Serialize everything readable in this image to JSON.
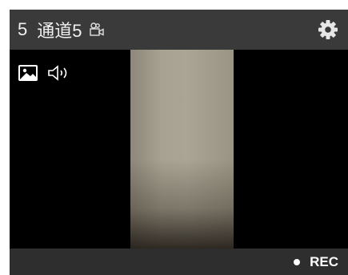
{
  "header": {
    "channel_number": "5",
    "channel_name": "通道5",
    "camera_icon": "camera-icon",
    "settings_icon": "gear-icon"
  },
  "video": {
    "image_icon": "image-icon",
    "audio_icon": "speaker-icon"
  },
  "footer": {
    "rec_label": "REC"
  },
  "colors": {
    "panel_bg": "#333333",
    "header_bg": "#3a3a3a",
    "video_bg": "#000000",
    "footer_bg": "#2e2e2e",
    "text": "#f0f0f0"
  }
}
